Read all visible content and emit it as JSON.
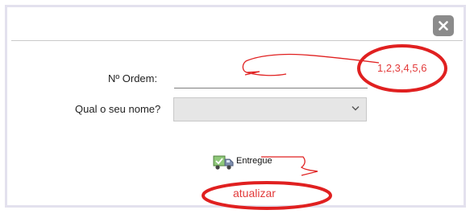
{
  "modal": {
    "close_icon": "close-x-icon"
  },
  "form": {
    "ordem_label": "Nº Ordem:",
    "ordem_value": "",
    "nome_label": "Qual o seu nome?",
    "nome_selected": "",
    "select_icon": "chevron-down-icon"
  },
  "status": {
    "icon": "delivery-truck-check-icon",
    "label": "Entregue"
  },
  "annotations": {
    "numbers_text": "1,2,3,4,5,6",
    "update_text": "atualizar",
    "color": "#e02020"
  }
}
